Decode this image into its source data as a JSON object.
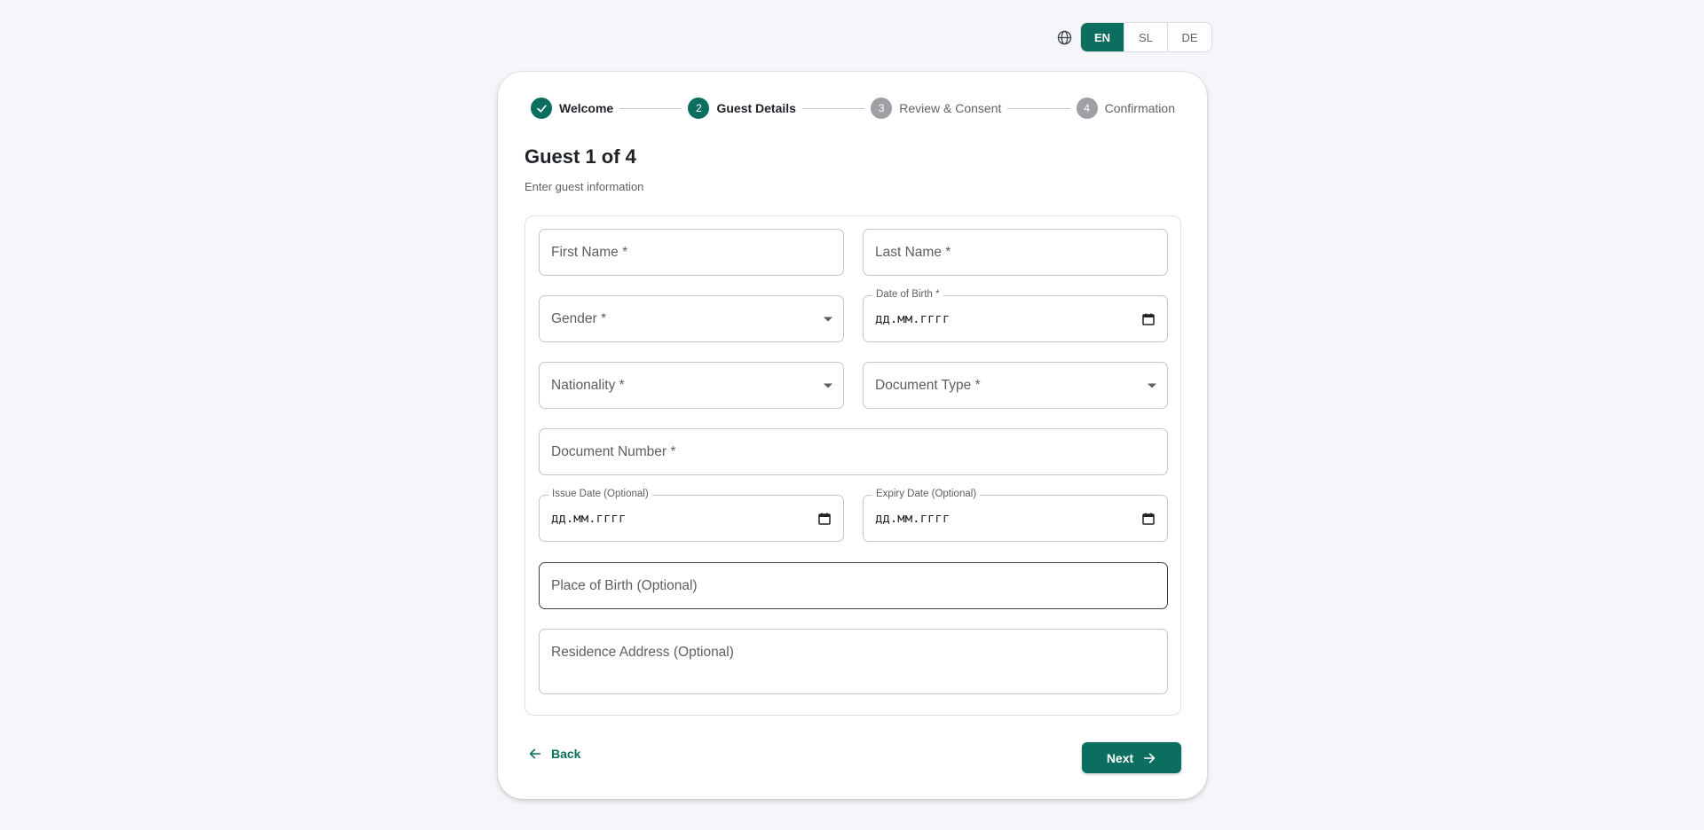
{
  "language": {
    "options": [
      "EN",
      "SL",
      "DE"
    ],
    "selected": "EN"
  },
  "stepper": {
    "steps": [
      {
        "number": "1",
        "label": "Welcome",
        "state": "completed"
      },
      {
        "number": "2",
        "label": "Guest Details",
        "state": "active"
      },
      {
        "number": "3",
        "label": "Review & Consent",
        "state": "pending"
      },
      {
        "number": "4",
        "label": "Confirmation",
        "state": "pending"
      }
    ]
  },
  "header": {
    "title": "Guest 1 of 4",
    "subtitle": "Enter guest information"
  },
  "form": {
    "first_name": {
      "label": "First Name *",
      "value": ""
    },
    "last_name": {
      "label": "Last Name *",
      "value": ""
    },
    "gender": {
      "label": "Gender *",
      "value": ""
    },
    "date_of_birth": {
      "label": "Date of Birth *",
      "value": "дд.мм.гггг"
    },
    "nationality": {
      "label": "Nationality *",
      "value": ""
    },
    "document_type": {
      "label": "Document Type *",
      "value": ""
    },
    "document_number": {
      "label": "Document Number *",
      "value": ""
    },
    "issue_date": {
      "label": "Issue Date (Optional)",
      "value": "дд.мм.гггг"
    },
    "expiry_date": {
      "label": "Expiry Date (Optional)",
      "value": "дд.мм.гггг"
    },
    "place_of_birth": {
      "label": "Place of Birth (Optional)",
      "value": ""
    },
    "residence_address": {
      "label": "Residence Address (Optional)",
      "value": ""
    }
  },
  "actions": {
    "back_label": "Back",
    "next_label": "Next"
  },
  "colors": {
    "primary": "#0b6e5e",
    "pending_step": "#9ea0a3",
    "background": "#f5f6f9"
  }
}
